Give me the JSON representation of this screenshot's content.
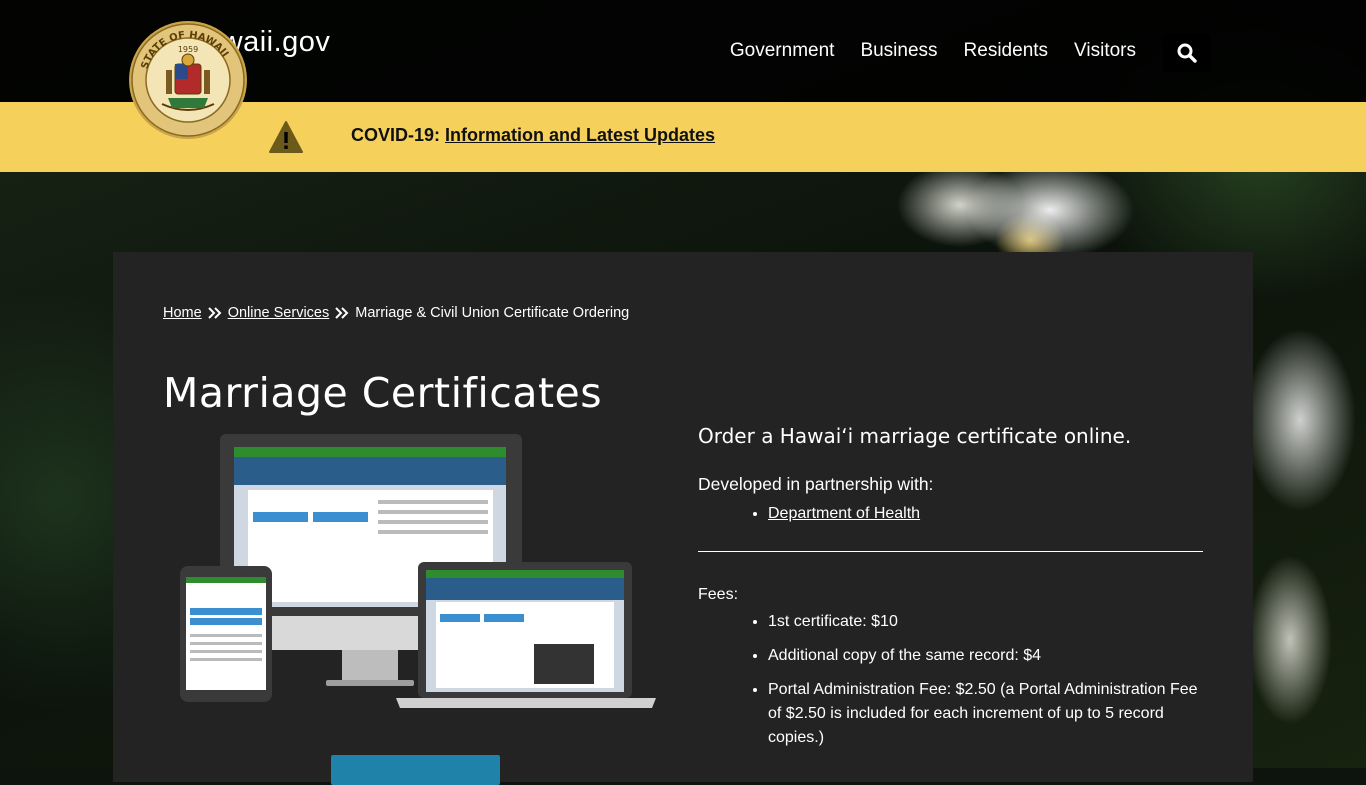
{
  "header": {
    "brand": "Hawaii.gov",
    "brand_visible": "awaii.gov",
    "seal_text": "STATE OF HAWAII",
    "seal_year": "1959",
    "nav": [
      "Government",
      "Business",
      "Residents",
      "Visitors"
    ]
  },
  "alert": {
    "prefix": "COVID-19:",
    "link": "Information and Latest Updates"
  },
  "breadcrumb": {
    "home": "Home",
    "online_services": "Online Services",
    "current": "Marriage & Civil Union Certificate Ordering"
  },
  "page": {
    "title": "Marriage Certificates",
    "lead": "Order a Hawaiʻi marriage certificate online.",
    "partner_label": "Developed in partnership with:",
    "partners": [
      "Department of Health"
    ],
    "fees_label": "Fees:",
    "fees": [
      "1st certificate: $10",
      "Additional copy of the same record: $4",
      "Portal Administration Fee: $2.50 (a Portal Administration Fee of $2.50 is included for each increment of up to 5 record copies.)"
    ]
  },
  "colors": {
    "alert_bg": "#f5d15c",
    "panel_bg": "#232323",
    "cta": "#1f82a8"
  }
}
